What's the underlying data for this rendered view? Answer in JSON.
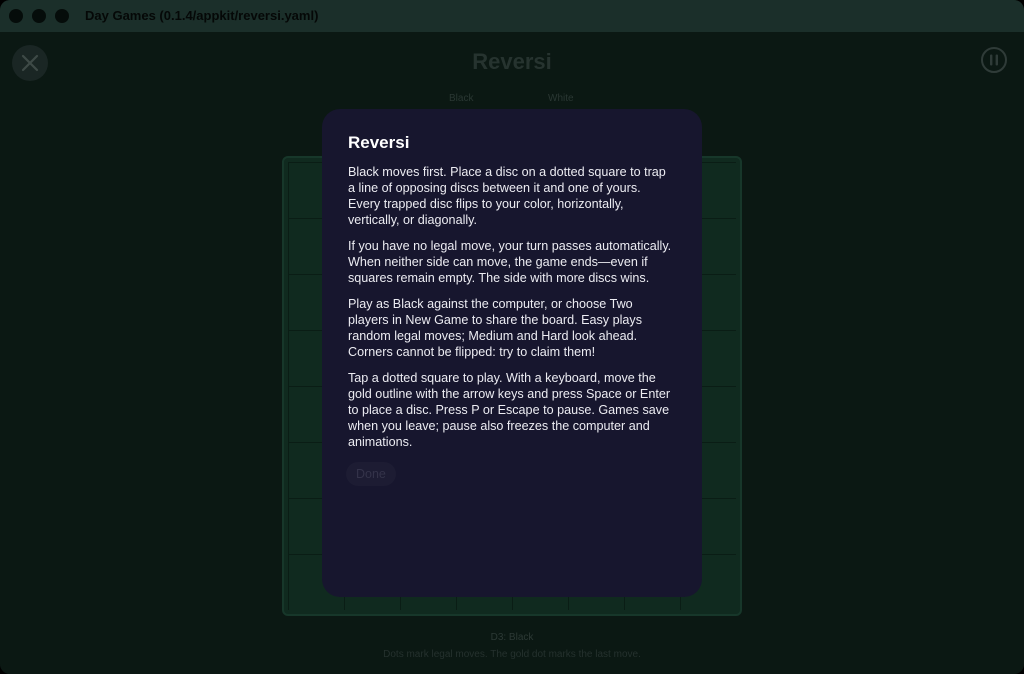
{
  "window": {
    "title": "Day Games (0.1.4/appkit/reversi.yaml)"
  },
  "header": {
    "title": "Reversi",
    "close_icon": "close-icon",
    "pause_icon": "pause-icon"
  },
  "players": {
    "black_label": "Black",
    "white_label": "White"
  },
  "board": {
    "rows": 8,
    "cols": 8
  },
  "status": {
    "move": "D3: Black",
    "hint": "Dots mark legal moves. The gold dot marks the last move."
  },
  "modal": {
    "title": "Reversi",
    "paragraphs": [
      "Black moves first. Place a disc on a dotted square to trap a line of opposing discs between it and one of yours. Every trapped disc flips to your color, horizontally, vertically, or diagonally.",
      "If you have no legal move, your turn passes automatically. When neither side can move, the game ends—even if squares remain empty. The side with more discs wins.",
      "Play as Black against the computer, or choose Two players in New Game to share the board. Easy plays random legal moves; Medium and Hard look ahead. Corners cannot be flipped: try to claim them!",
      "Tap a dotted square to play. With a keyboard, move the gold outline with the arrow keys and press Space or Enter to place a disc. Press P or Escape to pause. Games save when you leave; pause also freezes the computer and animations."
    ],
    "done_label": "Done"
  },
  "colors": {
    "modal_bg": "#17162e",
    "board_bg": "#102a1f",
    "titlebar_bg": "#1b2f2a"
  }
}
